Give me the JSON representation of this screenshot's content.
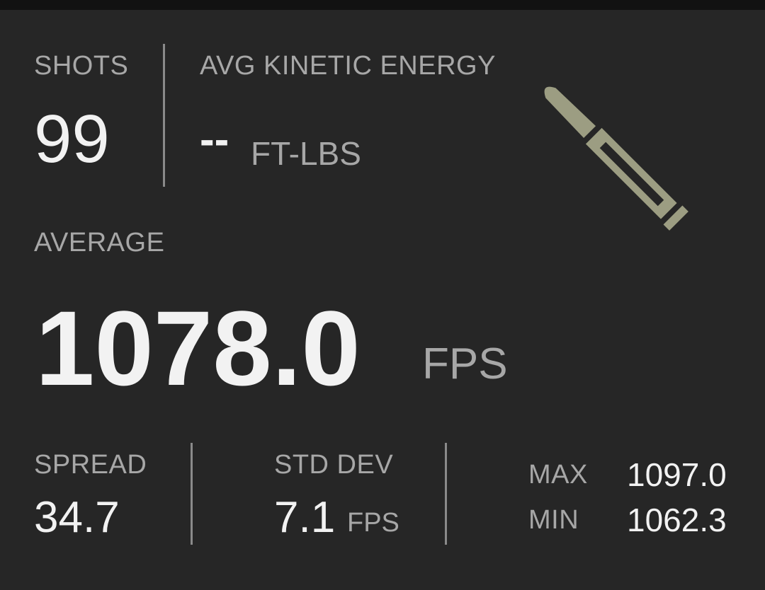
{
  "shots": {
    "label": "SHOTS",
    "value": "99"
  },
  "kinetic_energy": {
    "label": "AVG KINETIC ENERGY",
    "value": "--",
    "unit": "FT-LBS"
  },
  "average": {
    "label": "AVERAGE",
    "value": "1078.0",
    "unit": "FPS"
  },
  "spread": {
    "label": "SPREAD",
    "value": "34.7"
  },
  "std_dev": {
    "label": "STD DEV",
    "value": "7.1",
    "unit": "FPS"
  },
  "max": {
    "label": "MAX",
    "value": "1097.0"
  },
  "min": {
    "label": "MIN",
    "value": "1062.3"
  },
  "icon": {
    "name": "bullet-icon",
    "color": "#9c9d82"
  },
  "colors": {
    "background": "#262626",
    "text": "#f2f2f2",
    "muted": "#a7a7a7",
    "divider": "#8a8a8a"
  }
}
